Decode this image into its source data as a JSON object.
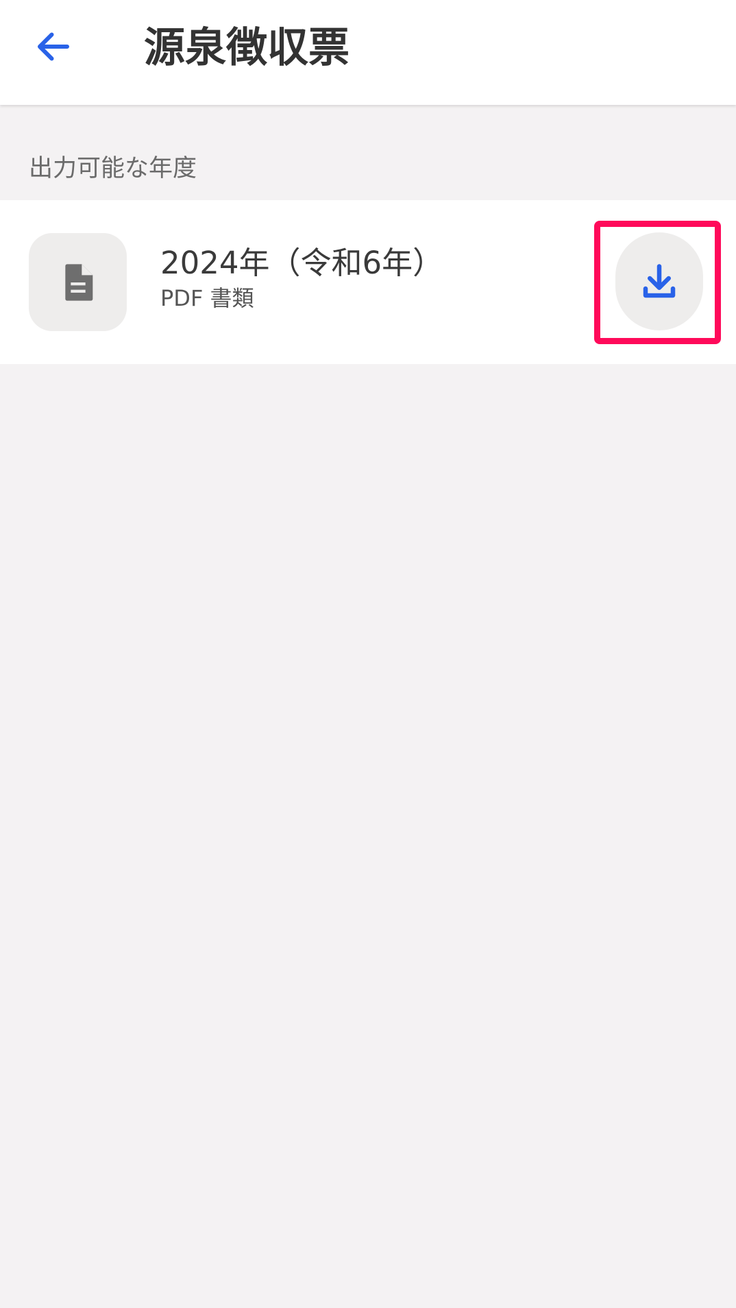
{
  "header": {
    "title": "源泉徴収票",
    "back_icon": "arrow-left-icon"
  },
  "section": {
    "label": "出力可能な年度"
  },
  "documents": [
    {
      "title": "2024年（令和6年）",
      "subtitle": "PDF 書類",
      "icon": "document-icon",
      "action_icon": "download-icon"
    }
  ],
  "colors": {
    "accent": "#2962e8",
    "highlight": "#ff0a5a",
    "background": "#f4f2f3",
    "surface": "#ffffff",
    "chip": "#eeedec",
    "icon_gray": "#6e6e6e"
  }
}
